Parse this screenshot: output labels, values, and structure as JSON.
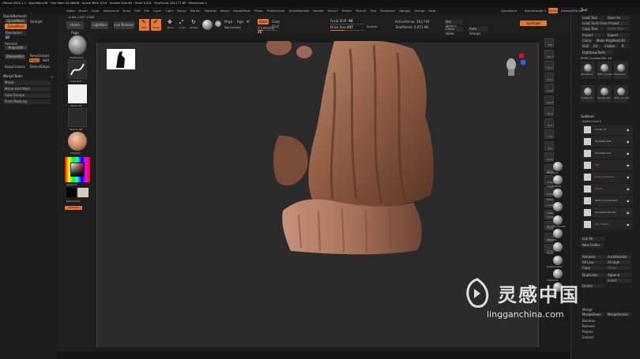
{
  "titlebar": {
    "text": "ZBrush 2020.1.1 · DyanWen128 · Free Mem 50.388GB · Active Mem 1023 · Scratch Disk 48 · Timer 0.001 · PolyCount 204.177 KP · MeshCount 1"
  },
  "menubar": {
    "items": [
      "Alpha",
      "Brush",
      "Color",
      "Document",
      "Draw",
      "Edit",
      "File",
      "Layer",
      "Light",
      "Macro",
      "Marker",
      "Material",
      "Movie",
      "MorphTools",
      "Picker",
      "Preferences",
      "QuickRemesh",
      "Render",
      "Stencil",
      "Stroke",
      "Texture",
      "Tool",
      "Transform",
      "Zplugin",
      "Zscript",
      "Help"
    ],
    "right": [
      "QuickSave",
      "See-through 0",
      "Menus",
      "DefaultZScript"
    ]
  },
  "left_panel": {
    "plugin_title": "QuickRemesh",
    "btn_quickmesh": "QuickMesh",
    "btn_straight": "Straight",
    "btn_dynamesh": "DynaMesh",
    "resolution_label": "Resolution",
    "resolution_value": "80",
    "remesh_label": "Remesh",
    "project_all": "ProjectAll",
    "zremesher": "ZRemesher",
    "keep_groups": "KeepGroups",
    "adapt": "Adapt",
    "half": "Half",
    "keep_creases": "KeepCreases",
    "detect_edges": "DetectEdges",
    "morph_title": "MorphTools",
    "mirror": "Mirror",
    "mirror_weld": "Mirror And Weld",
    "auto_groups": "Auto Groups",
    "from_masking": "From Masking"
  },
  "top_toolbar": {
    "home_page": "Home Page",
    "lightbox": "LightBox",
    "live_boolean": "Live Boolean",
    "edit": "Edit",
    "draw": "Draw",
    "move": "Move",
    "scale": "Scale",
    "rotate": "Rotate",
    "mrgb": "Mrgb",
    "rgb": "Rgb",
    "m": "M",
    "zadd": "Zadd",
    "zsub": "Zsub",
    "zcut": "Zcut",
    "focal_shift_label": "Focal Shift",
    "focal_shift_value": "-94",
    "draw_size_label": "Draw Size",
    "draw_size_value": "437",
    "dynamic": "Dynamic",
    "active_points_label": "ActivePoints:",
    "active_points_value": "263,799",
    "total_points_label": "TotalPoints:",
    "total_points_value": "4.871 Mil",
    "rgb_intensity": "Rgb Intensity",
    "z_intensity_label": "Z Intensity",
    "z_intensity_value": "26",
    "del_hidden": "Del Hidden",
    "close_holes": "Close Holes",
    "auto_groups": "Auto Groups",
    "spotlight": "Spotlight Projection",
    "coords": "-0.165,-0.847,-0.508"
  },
  "left_shelf": {
    "brush_label": "ClayBuildup",
    "stroke_label": "FreeHand",
    "alpha_label": "Alpha Off",
    "texture_label": "Texture Off",
    "material_label": "PolySkin",
    "gradient_label": "Gradient",
    "switch_color": "SwitchColor",
    "alternate": "Alternate"
  },
  "right_brushes": [
    "Standard",
    "ClayBuildup",
    "Move",
    "Inflat",
    "Smooth Groups",
    "Smooth",
    "Pinch",
    "TrimDynamic",
    "ClipCurve",
    "SK_Slash"
  ],
  "right_vtools": [
    "BPR",
    "SPix 3",
    "Scroll",
    "Zoom",
    "Actual",
    "AAHalf",
    "Persp",
    "Floor",
    "Local",
    "Gxyz",
    "Frame",
    "Move",
    "Scale",
    "Rotate",
    "Line Fill",
    "Transp",
    "Ghost",
    "Solo",
    "Xpose"
  ],
  "tool_panel": {
    "title": "Tool",
    "load_tool": "Load Tool",
    "save_as": "Save As",
    "load_from_project": "Load Tools From Project",
    "copy_tool": "Copy Tool",
    "paste_tool": "Paste Tool",
    "import": "Import",
    "export": "Export",
    "clone": "Clone",
    "make_polymesh": "Make PolyMesh3D",
    "goz": "GoZ",
    "all": "All",
    "visible": "Visible",
    "r": "R",
    "lightbox_tools": "Lightbox▸Tools",
    "current_tool": "PM3D_Cylinder3D2. 48",
    "thumbs": [
      "SphereBrush",
      "PM3D_Cylinder3",
      "SimpleBrush",
      "PolyMesh3D",
      "DynaWen128",
      "PM3D_Cylinder3"
    ],
    "subtool_title": "Subtool",
    "visible_count": "Visible Count 9",
    "subtools": [
      "pixtail_s3",
      "DynaWen128",
      "DynaWen128",
      "hair",
      "body_backbone",
      "hands",
      "PM3D_Cylinder3D2",
      "DynaWen128.001",
      "skin helpers"
    ],
    "list_all": "List All",
    "new_folder": "New Folder",
    "rename": "Rename",
    "autoreorder": "AutoReorder",
    "all_low": "All Low",
    "all_high": "All High",
    "copy": "Copy",
    "paste": "Paste",
    "duplicate": "Duplicate",
    "append": "Append",
    "insert": "Insert",
    "delete": "Delete",
    "merge": "Merge",
    "merge_down": "MergeDown",
    "merge_similar": "MergeSimilar",
    "boolean": "Boolean",
    "remesh": "Remesh",
    "project": "Project",
    "extract": "Extract"
  },
  "watermark": {
    "cn": "灵感中国",
    "url": "lingganchina.com"
  }
}
